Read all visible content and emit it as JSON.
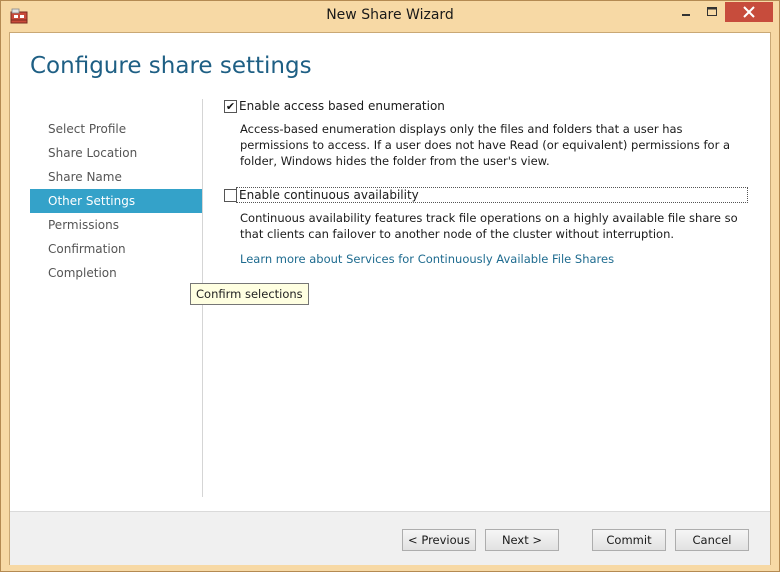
{
  "window": {
    "title": "New Share Wizard"
  },
  "page": {
    "title": "Configure share settings"
  },
  "nav": {
    "items": [
      {
        "label": "Select Profile"
      },
      {
        "label": "Share Location"
      },
      {
        "label": "Share Name"
      },
      {
        "label": "Other Settings"
      },
      {
        "label": "Permissions"
      },
      {
        "label": "Confirmation"
      },
      {
        "label": "Completion"
      }
    ]
  },
  "tooltip": {
    "text": "Confirm selections"
  },
  "options": {
    "abe": {
      "label": "Enable access based enumeration",
      "checked": true,
      "description": "Access-based enumeration displays only the files and folders that a user has permissions to access. If a user does not have Read (or equivalent) permissions for a folder, Windows hides the folder from the user's view."
    },
    "ca": {
      "label": "Enable continuous availability",
      "checked": false,
      "description": "Continuous availability features track file operations on a highly available file share so that clients can failover to another node of the cluster without interruption."
    }
  },
  "link": {
    "text": "Learn more about Services for Continuously Available File Shares"
  },
  "buttons": {
    "previous": "< Previous",
    "next": "Next >",
    "commit": "Commit",
    "cancel": "Cancel"
  },
  "colors": {
    "frame": "#f7d9a5",
    "accent": "#34a2c9",
    "title_blue": "#1e5f84",
    "link": "#1e6b8f",
    "close": "#c74c3c"
  },
  "icons": {
    "app": "share-folder-icon",
    "minimize": "minimize-icon",
    "maximize": "maximize-icon",
    "close": "close-icon",
    "check": "checkmark-icon"
  }
}
